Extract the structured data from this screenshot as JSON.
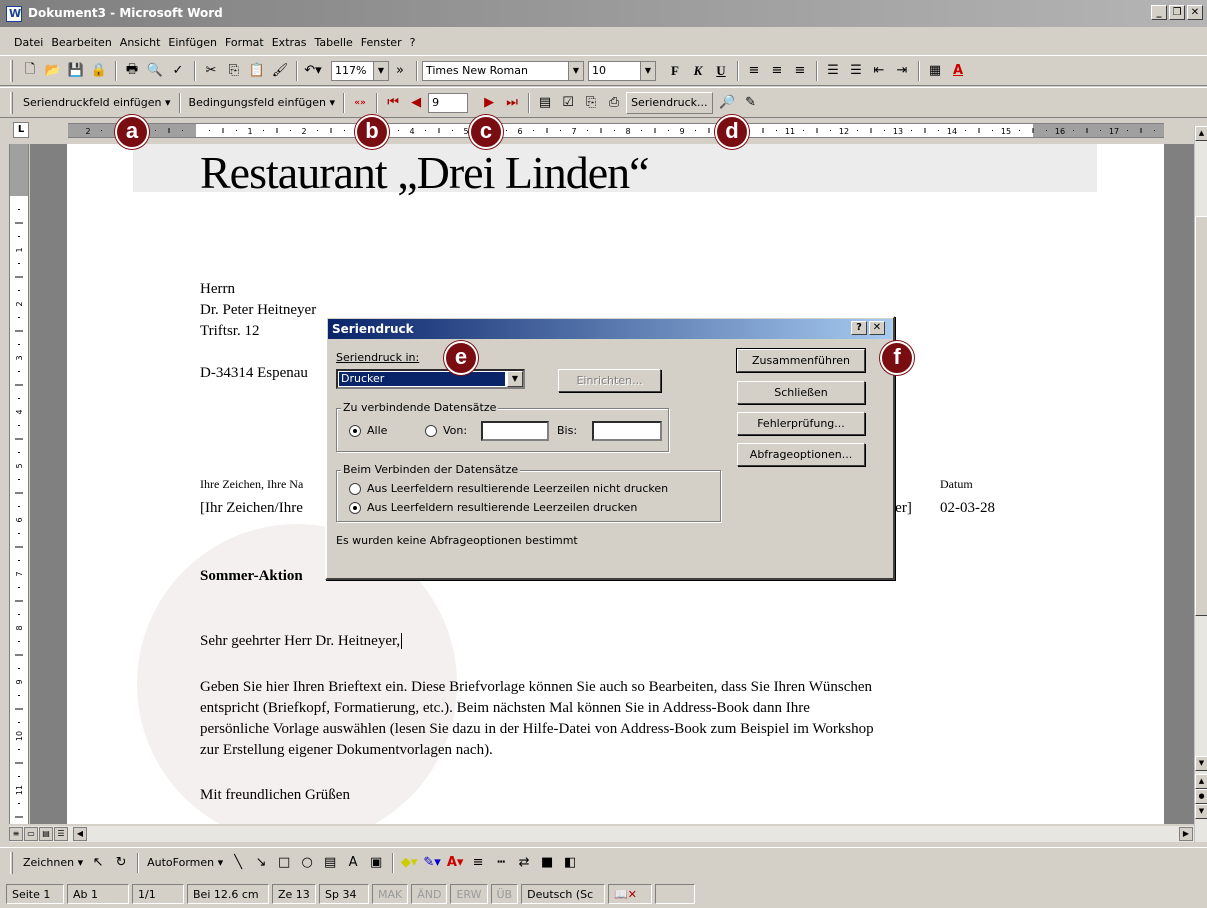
{
  "window": {
    "title": "Dokument3 - Microsoft Word"
  },
  "menu": [
    "Datei",
    "Bearbeiten",
    "Ansicht",
    "Einfügen",
    "Format",
    "Extras",
    "Tabelle",
    "Fenster",
    "?"
  ],
  "standard_toolbar": {
    "zoom": "117%",
    "font": "Times New Roman",
    "size": "10"
  },
  "mailmerge_toolbar": {
    "insert_merge_field": "Seriendruckfeld einfügen ▾",
    "insert_word_field": "Bedingungsfeld einfügen ▾",
    "record_number": "9",
    "merge_button": "Seriendruck..."
  },
  "document": {
    "heading": "Restaurant „Drei Linden“",
    "address": [
      "Herrn",
      "Dr. Peter Heitneyer",
      "Triftsr. 12",
      "D-34314 Espenau"
    ],
    "ref_label": "Ihre Zeichen, Ihre Na",
    "ref_value": "[Ihr Zeichen/Ihre",
    "ref_value_right": "ter]",
    "date_label": "Datum",
    "date_value": "02-03-28",
    "subject": "Sommer-Aktion",
    "salutation": "Sehr geehrter Herr Dr. Heitneyer,",
    "body": [
      "Geben Sie hier Ihren Brieftext ein. Diese Briefvorlage können Sie auch so Bearbeiten, dass Sie Ihren Wünschen",
      "entspricht (Briefkopf, Formatierung, etc.). Beim nächsten Mal können Sie in Address-Book dann Ihre",
      "persönliche Vorlage auswählen (lesen Sie dazu in der Hilfe-Datei von Address-Book zum Beispiel im Workshop",
      "zur Erstellung eigener Dokumentvorlagen nach)."
    ],
    "closing": "Mit freundlichen Grüßen"
  },
  "dialog": {
    "title": "Seriendruck",
    "merge_to_label": "Seriendruck in:",
    "merge_to_value": "Drucker",
    "setup_button": "Einrichten...",
    "records_group": "Zu verbindende Datensätze",
    "radio_all": "Alle",
    "radio_from": "Von:",
    "to_label": "Bis:",
    "blank_group": "Beim Verbinden der Datensätze",
    "blank_option1": "Aus Leerfeldern resultierende Leerzeilen nicht drucken",
    "blank_option2": "Aus Leerfeldern resultierende Leerzeilen drucken",
    "status": "Es wurden keine Abfrageoptionen bestimmt",
    "buttons": {
      "merge": "Zusammenführen",
      "close": "Schließen",
      "check": "Fehlerprüfung...",
      "query": "Abfrageoptionen..."
    }
  },
  "markers": [
    "a",
    "b",
    "c",
    "d",
    "e",
    "f"
  ],
  "drawing_toolbar": {
    "draw": "Zeichnen ▾",
    "autoshapes": "AutoFormen ▾"
  },
  "status_bar": {
    "page": "Seite 1",
    "section": "Ab 1",
    "pages": "1/1",
    "position": "Bei 12.6 cm",
    "line": "Ze 13",
    "col": "Sp 34",
    "rec": "MAK",
    "trk": "ÄND",
    "ext": "ERW",
    "ovr": "ÜB",
    "language": "Deutsch (Sc"
  },
  "ruler": {
    "numbers": [
      "2",
      "1",
      "1",
      "2",
      "3",
      "4",
      "5",
      "6",
      "7",
      "8",
      "9",
      "10",
      "11",
      "12",
      "13",
      "14",
      "15",
      "16",
      "17",
      "18"
    ]
  },
  "vruler": {
    "numbers": [
      "1",
      "2",
      "3",
      "4",
      "5",
      "6",
      "7",
      "8",
      "9",
      "10",
      "11",
      "12"
    ]
  }
}
